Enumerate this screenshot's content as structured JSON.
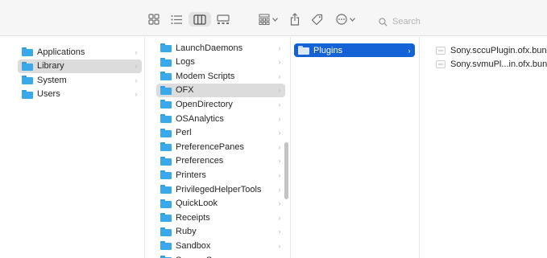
{
  "toolbar": {
    "icons": [
      "icon-view-icon",
      "list-view-icon",
      "column-view-icon",
      "gallery-view-icon",
      "group-icon",
      "share-icon",
      "tag-icon",
      "more-icon"
    ],
    "search_placeholder": "Search"
  },
  "columns": {
    "col1": [
      {
        "label": "Applications",
        "has_arrow": true
      },
      {
        "label": "Library",
        "has_arrow": true,
        "selected": true
      },
      {
        "label": "System",
        "has_arrow": true
      },
      {
        "label": "Users",
        "has_arrow": true
      }
    ],
    "col2": [
      {
        "label": "LaunchDaemons"
      },
      {
        "label": "Logs"
      },
      {
        "label": "Modem Scripts"
      },
      {
        "label": "OFX",
        "selected": true
      },
      {
        "label": "OpenDirectory"
      },
      {
        "label": "OSAnalytics"
      },
      {
        "label": "Perl"
      },
      {
        "label": "PreferencePanes"
      },
      {
        "label": "Preferences"
      },
      {
        "label": "Printers"
      },
      {
        "label": "PrivilegedHelperTools"
      },
      {
        "label": "QuickLook"
      },
      {
        "label": "Receipts"
      },
      {
        "label": "Ruby"
      },
      {
        "label": "Sandbox"
      },
      {
        "label": "Screen Savers"
      }
    ],
    "col3": [
      {
        "label": "Plugins",
        "selected": true
      }
    ],
    "col4": [
      {
        "label": "Sony.sccuPlugin.ofx.bundle"
      },
      {
        "label": "Sony.svmuPl...in.ofx.bundle"
      }
    ]
  }
}
